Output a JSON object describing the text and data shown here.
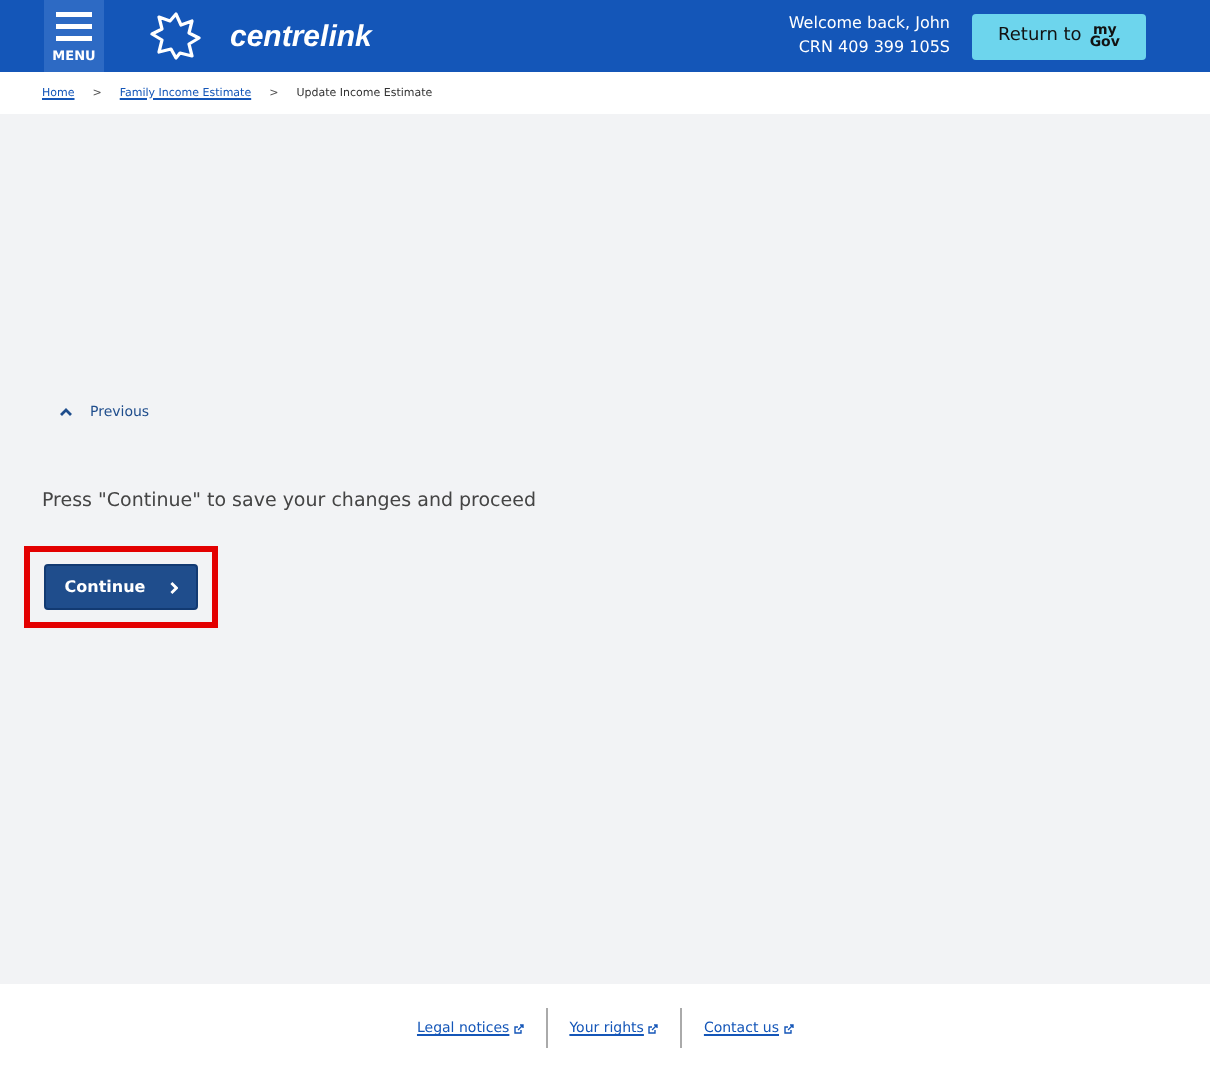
{
  "header": {
    "menu_label": "MENU",
    "brand": "centrelink",
    "welcome": "Welcome back, John",
    "crn": "CRN 409 399 105S",
    "return_button": {
      "label": "Return to",
      "logo_top": "my",
      "logo_bottom": "Gov"
    }
  },
  "breadcrumbs": [
    {
      "label": "Home",
      "link": true
    },
    {
      "label": "Family Income Estimate",
      "link": true
    },
    {
      "label": "Update Income Estimate",
      "link": false
    }
  ],
  "breadcrumb_separator": ">",
  "previous_label": "Previous",
  "instruction": "Press \"Continue\" to save your changes and proceed",
  "continue_button": {
    "label": "Continue",
    "highlighted": true
  },
  "footer_links": [
    "Legal notices",
    "Your rights",
    "Contact us"
  ]
}
